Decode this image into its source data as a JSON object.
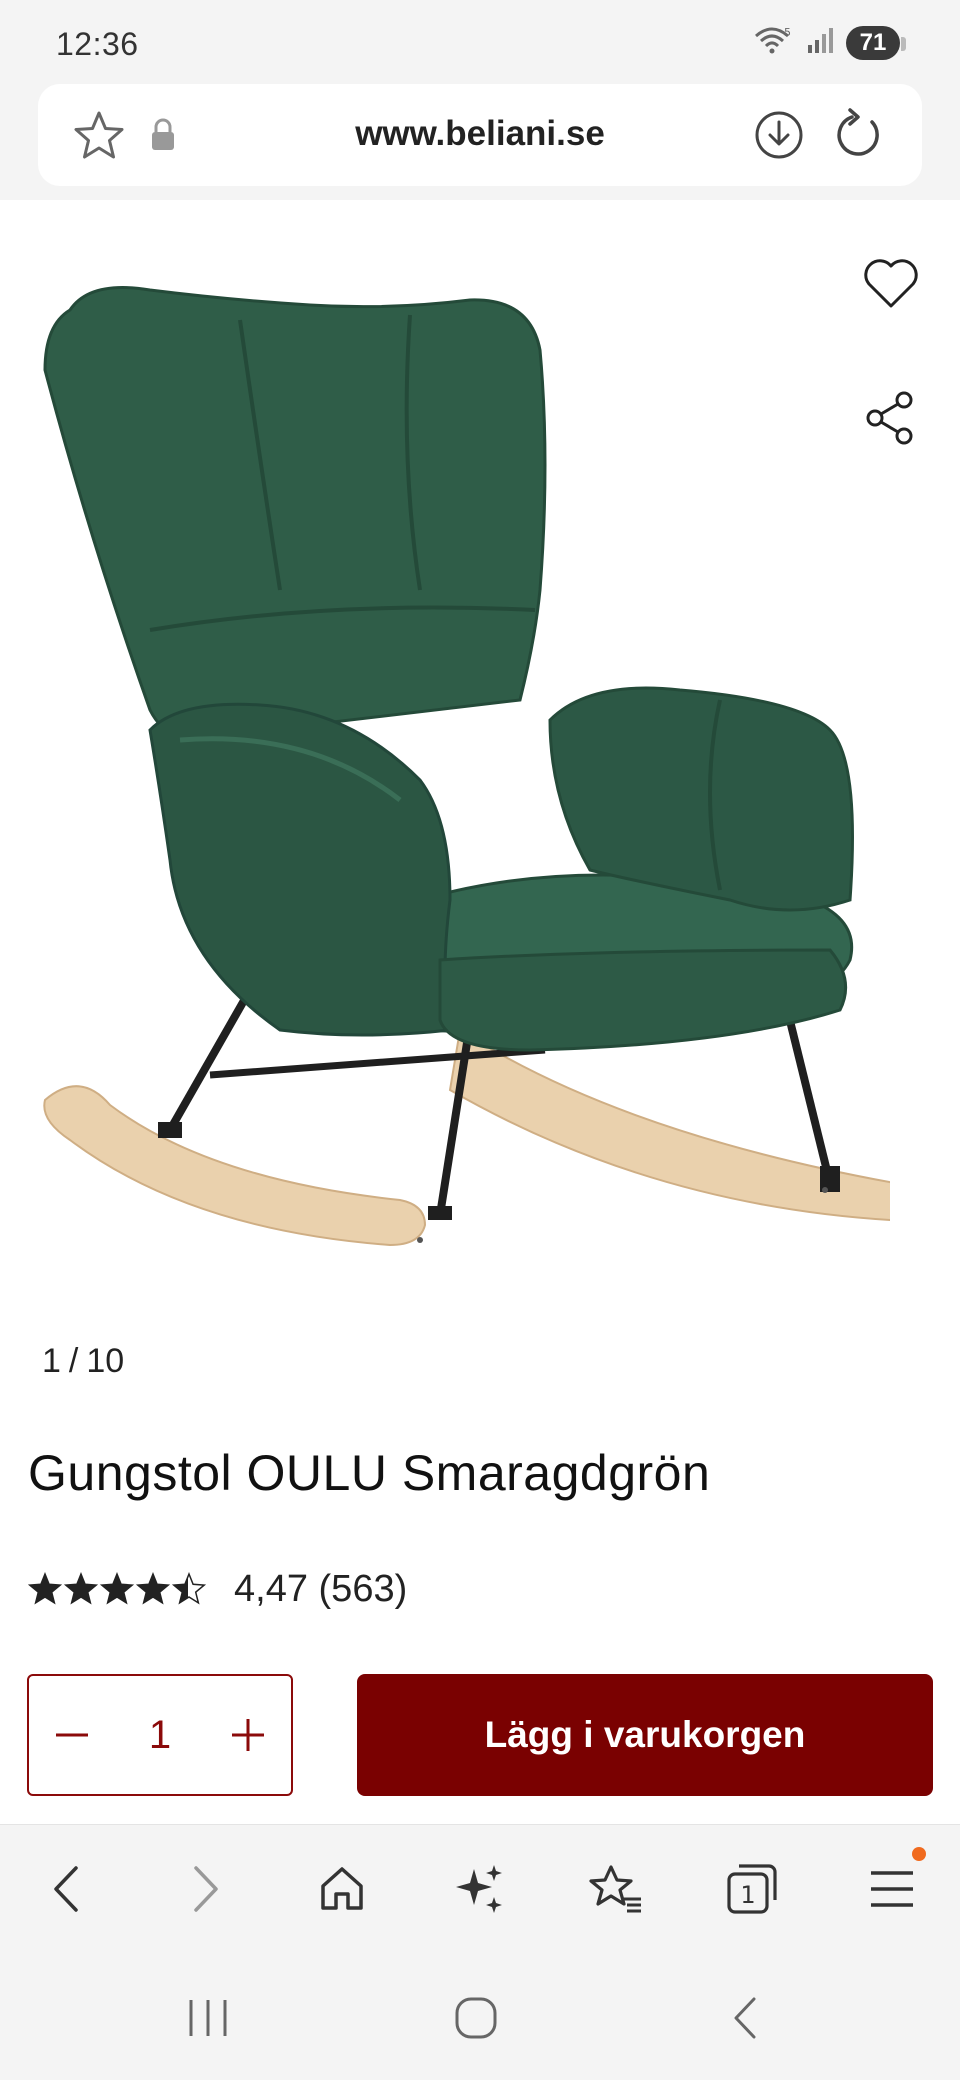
{
  "status_bar": {
    "time": "12:36",
    "battery": "71"
  },
  "address_bar": {
    "url": "www.beliani.se"
  },
  "product": {
    "gallery": {
      "current": "1",
      "separator": "/",
      "total": "10"
    },
    "title": "Gungstol OULU Smaragdgrön",
    "rating": {
      "value": 4.47,
      "max": 5,
      "score_text": "4,47",
      "count_text": "(563)"
    },
    "quantity": "1",
    "add_to_cart_label": "Lägg i varukorgen"
  },
  "colors": {
    "brand": "#7a0101",
    "chair_green": "#2f5d48",
    "wood": "#ead1ad",
    "notification": "#f06a1e"
  },
  "icons": {
    "address": [
      "star-icon",
      "lock-icon",
      "download-icon",
      "reload-icon"
    ],
    "product": [
      "heart-icon",
      "share-icon"
    ],
    "toolbar": [
      "back-icon",
      "forward-icon",
      "home-icon",
      "sparkle-icon",
      "favorites-icon",
      "tabs-icon",
      "menu-icon"
    ],
    "system": [
      "recents-icon",
      "home-circle-icon",
      "system-back-icon"
    ]
  },
  "toolbar": {
    "tabs_count": "1"
  }
}
